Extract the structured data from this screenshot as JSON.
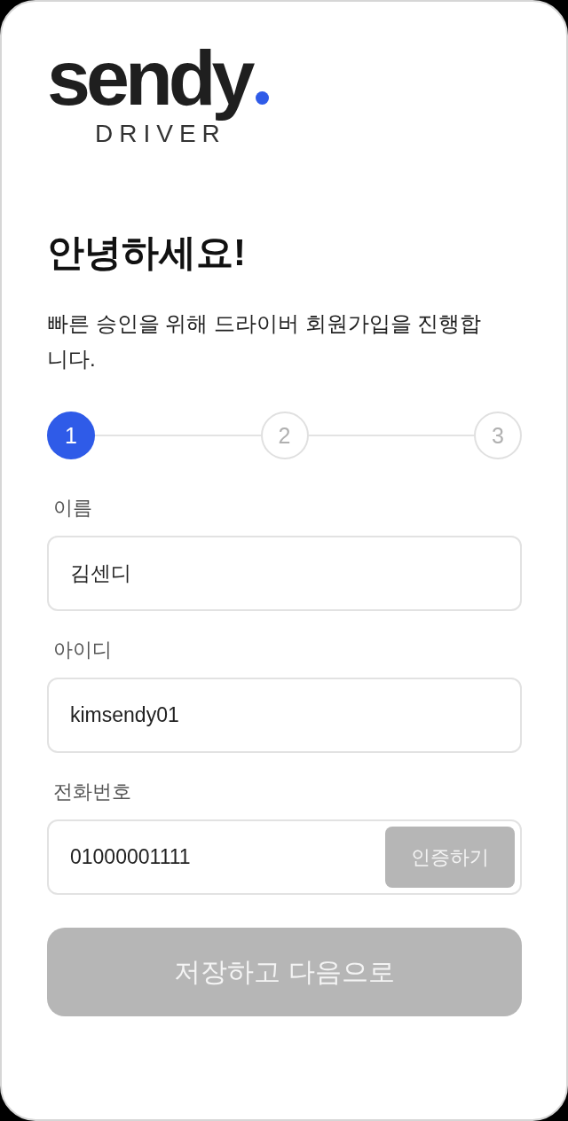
{
  "logo": {
    "wordmark": "sendy",
    "subtitle": "DRIVER"
  },
  "heading": "안녕하세요!",
  "intro": "빠른 승인을 위해 드라이버 회원가입을 진행합니다.",
  "steps": [
    {
      "label": "1",
      "selected": true
    },
    {
      "label": "2",
      "selected": false
    },
    {
      "label": "3",
      "selected": false
    }
  ],
  "fields": [
    {
      "label": "이름",
      "value": "김센디"
    },
    {
      "label": "아이디",
      "value": "kimsendy01"
    },
    {
      "label": "전화번호",
      "value": "01000001111",
      "action": {
        "label": "인증하기",
        "disabled": true
      }
    }
  ],
  "submit": {
    "label": "저장하고 다음으로",
    "disabled": true
  }
}
